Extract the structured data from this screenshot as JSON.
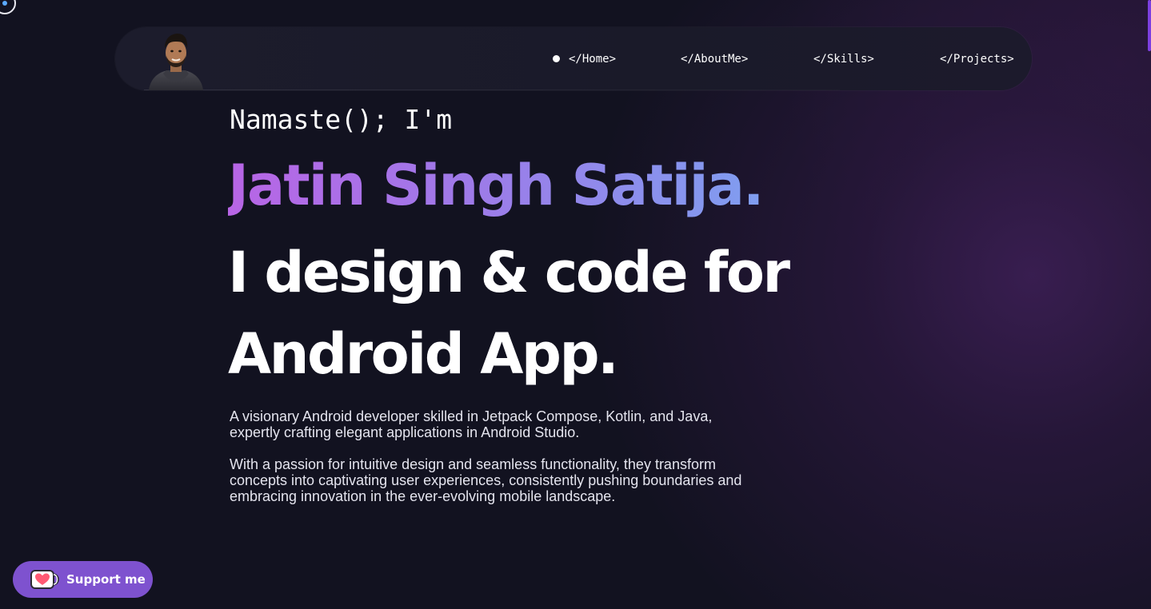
{
  "nav": {
    "links": [
      {
        "label": "</Home>",
        "active": true
      },
      {
        "label": "</AboutMe>",
        "active": false
      },
      {
        "label": "</Skills>",
        "active": false
      },
      {
        "label": "</Projects>",
        "active": false
      }
    ]
  },
  "hero": {
    "greeting": "Namaste(); I'm",
    "name": "Jatin Singh Satija.",
    "headline_line1": "I design & code for",
    "headline_line2": "Android App.",
    "paragraph1": "A visionary Android developer skilled in Jetpack Compose, Kotlin, and Java, expertly crafting elegant applications in Android Studio.",
    "paragraph2": "With a passion for intuitive design and seamless functionality, they transform concepts into captivating user experiences, consistently pushing boundaries and embracing innovation in the ever-evolving mobile landscape."
  },
  "support": {
    "label": "Support me",
    "icon": "coffee-cup-heart-icon"
  },
  "colors": {
    "background": "#121220",
    "accent": "#7e52cf",
    "name_gradient_start": "#b865e6",
    "name_gradient_end": "#7f9ef0",
    "scroll_indicator": "#7c3fe0"
  }
}
